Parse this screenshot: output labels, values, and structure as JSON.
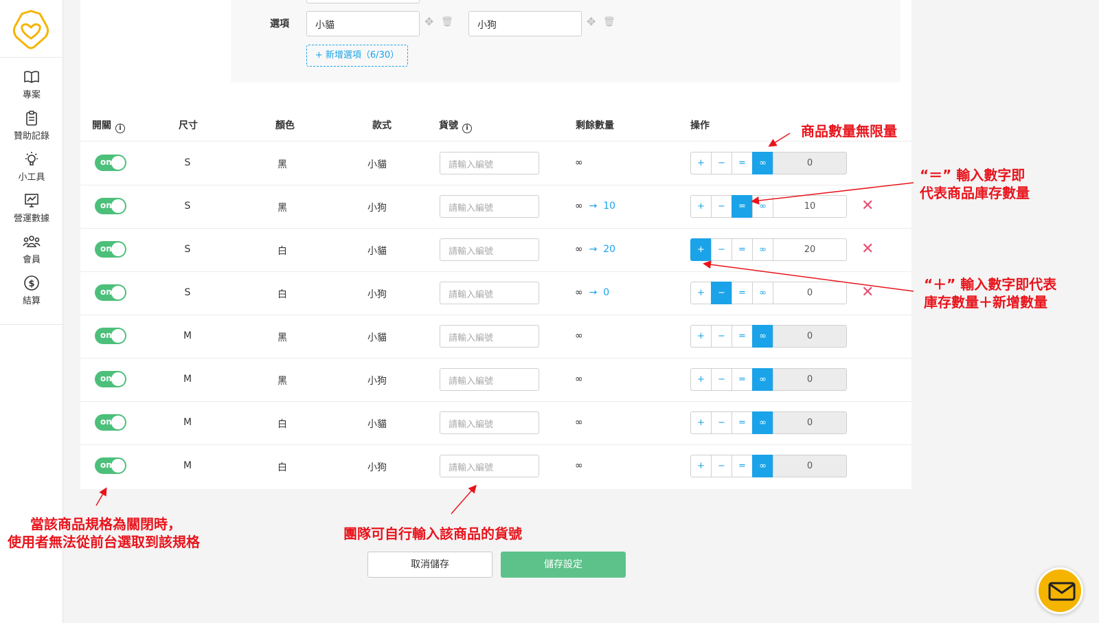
{
  "sidebar": {
    "items": [
      {
        "label": "專案",
        "icon": "book-icon"
      },
      {
        "label": "贊助記錄",
        "icon": "clipboard-icon"
      },
      {
        "label": "小工具",
        "icon": "lightbulb-icon"
      },
      {
        "label": "營運數據",
        "icon": "chart-icon"
      },
      {
        "label": "會員",
        "icon": "users-icon"
      },
      {
        "label": "結算",
        "icon": "dollar-icon"
      }
    ]
  },
  "options": {
    "label": "選項",
    "values": [
      "小貓",
      "小狗"
    ],
    "add_label": "+ 新增選項（6/30）"
  },
  "table": {
    "headers": {
      "toggle": "開關",
      "size": "尺寸",
      "color": "顏色",
      "style": "款式",
      "sku": "貨號",
      "remain": "剩餘數量",
      "ops": "操作"
    },
    "toggle_label": "on",
    "sku_placeholder": "請輸入編號",
    "infinity": "∞",
    "arrow": "→",
    "op_buttons": [
      "+",
      "−",
      "=",
      "∞"
    ],
    "rows": [
      {
        "size": "S",
        "color": "黑",
        "style": "小貓",
        "remain_to": "",
        "active_op": 3,
        "value": "0",
        "deletable": false
      },
      {
        "size": "S",
        "color": "黑",
        "style": "小狗",
        "remain_to": "10",
        "active_op": 2,
        "value": "10",
        "deletable": true
      },
      {
        "size": "S",
        "color": "白",
        "style": "小貓",
        "remain_to": "20",
        "active_op": 0,
        "value": "20",
        "deletable": true
      },
      {
        "size": "S",
        "color": "白",
        "style": "小狗",
        "remain_to": "0",
        "active_op": 1,
        "value": "0",
        "deletable": true
      },
      {
        "size": "M",
        "color": "黑",
        "style": "小貓",
        "remain_to": "",
        "active_op": 3,
        "value": "0",
        "deletable": false
      },
      {
        "size": "M",
        "color": "黑",
        "style": "小狗",
        "remain_to": "",
        "active_op": 3,
        "value": "0",
        "deletable": false
      },
      {
        "size": "M",
        "color": "白",
        "style": "小貓",
        "remain_to": "",
        "active_op": 3,
        "value": "0",
        "deletable": false
      },
      {
        "size": "M",
        "color": "白",
        "style": "小狗",
        "remain_to": "",
        "active_op": 3,
        "value": "0",
        "deletable": false
      }
    ]
  },
  "annotations": {
    "unlimited": "商品數量無限量",
    "equals_1": "“＝” 輸入數字即",
    "equals_2": "代表商品庫存數量",
    "plus_1": "“＋” 輸入數字即代表",
    "plus_2": "庫存數量＋新增數量",
    "toggle_1": "當該商品規格為關閉時，",
    "toggle_2": "使用者無法從前台選取到該規格",
    "sku": "團隊可自行輸入該商品的貨號"
  },
  "buttons": {
    "cancel": "取消儲存",
    "save": "儲存設定"
  },
  "colors": {
    "accent": "#1aa3e8",
    "toggle_on": "#4cc07a",
    "save": "#5cc28a",
    "annotation": "#e8141c",
    "delete": "#e84c6f",
    "brand": "#f5b400"
  }
}
